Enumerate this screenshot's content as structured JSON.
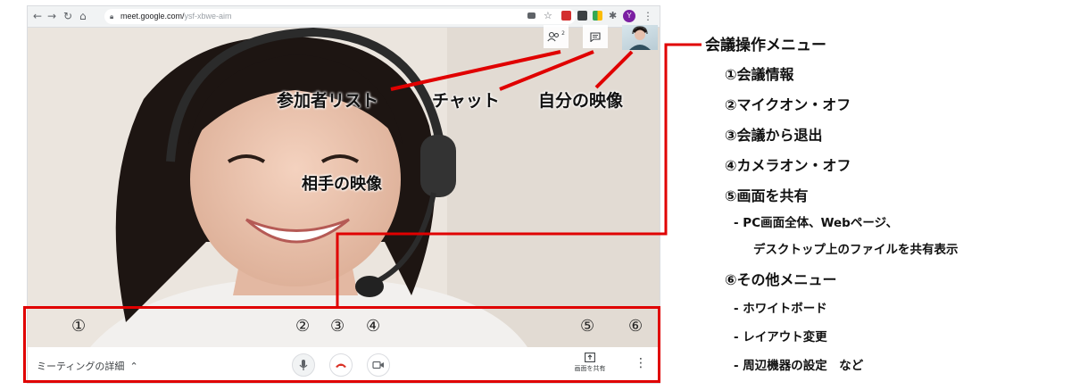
{
  "browser": {
    "url_host": "meet.google.com/",
    "url_path": "ysf-xbwe-aim",
    "profile_initial": "Y"
  },
  "meet": {
    "detail_label": "ミーティングの詳細",
    "share_label": "画面を共有",
    "participant_count": "2"
  },
  "callouts": {
    "participants": "参加者リスト",
    "chat": "チャット",
    "self_video": "自分の映像",
    "remote_video": "相手の映像"
  },
  "numbers": [
    "①",
    "②",
    "③",
    "④",
    "⑤",
    "⑥"
  ],
  "menu": {
    "title": "会議操作メニュー",
    "items": [
      "①会議情報",
      "②マイクオン・オフ",
      "③会議から退出",
      "④カメラオン・オフ",
      "⑤画面を共有",
      "⑥その他メニュー"
    ],
    "share_subs": [
      "- PC画面全体、Webページ、",
      "デスクトップ上のファイルを共有表示"
    ],
    "more_subs": [
      "- ホワイトボード",
      "- レイアウト変更",
      "- 周辺機器の設定　など"
    ]
  },
  "colors": {
    "annotation_red": "#e00000",
    "hangup_red": "#d93025"
  }
}
